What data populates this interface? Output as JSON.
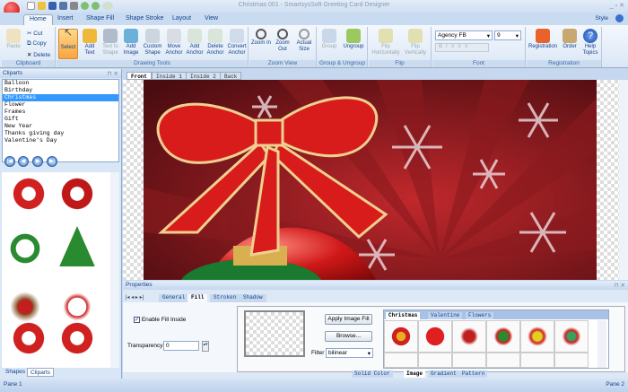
{
  "window": {
    "title": "Christmas 001 - SmartsysSoft Greeting Card Designer",
    "style_label": "Style"
  },
  "tabs": [
    "Home",
    "Insert",
    "Shape Fill",
    "Shape Stroke",
    "Layout",
    "View"
  ],
  "ribbon": {
    "clipboard": {
      "label": "Clipboard",
      "paste": "Paste",
      "cut": "Cut",
      "copy": "Copy",
      "delete": "Delete"
    },
    "drawing": {
      "label": "Drawing Tools",
      "buttons": [
        "Select",
        "Add Text",
        "Text to Shape",
        "Add Image",
        "Custom Shape",
        "Move Anchor",
        "Add Anchor",
        "Delete Anchor",
        "Convert Anchor"
      ]
    },
    "zoom": {
      "label": "Zoom View",
      "buttons": [
        "Zoom In",
        "Zoom Out",
        "Actual Size"
      ]
    },
    "group": {
      "label": "Group & Ungroup",
      "buttons": [
        "Group",
        "Ungroup"
      ]
    },
    "flip": {
      "label": "Flip",
      "buttons": [
        "Flip Horizontally",
        "Flip Vertically"
      ]
    },
    "font": {
      "label": "Font",
      "family": "Agency FB",
      "size": "9",
      "styles": [
        "B",
        "I",
        "≡",
        "≡",
        "≡"
      ]
    },
    "registration": {
      "label": "Registration",
      "buttons": [
        "Registration",
        "Order",
        "Help Topics"
      ]
    }
  },
  "cliparts": {
    "title": "Cliparts",
    "categories": [
      "Balloon",
      "Birthday",
      "Christmas",
      "Flower",
      "Frames",
      "Gift",
      "New Year",
      "Thanks giving day",
      "Valentine's Day"
    ],
    "selected": "Christmas",
    "bottom_tabs": [
      "Shapes",
      "Cliparts"
    ]
  },
  "document": {
    "tabs": [
      "Front",
      "Inside 1",
      "Inside 2",
      "Back"
    ],
    "active": "Front"
  },
  "properties": {
    "title": "Properties",
    "tabs": [
      "General",
      "Fill",
      "Stroken",
      "Shadow"
    ],
    "active": "Fill",
    "enable_fill": "Enable Fill Inside",
    "enable_fill_checked": true,
    "transparency_label": "Transparency",
    "transparency": "0",
    "apply_button": "Apply Image Fill",
    "browse_button": "Browse...",
    "filter_label": "Filter",
    "filter": "bilinear",
    "fill_tabs": [
      "Solid Color",
      "Image",
      "Gradient",
      "Pattern"
    ],
    "active_fill_tab": "Image"
  },
  "clipart_gallery": {
    "tabs": [
      "Christmas",
      "Valentine",
      "Flowers"
    ],
    "active": "Christmas"
  },
  "status": {
    "left": "Pane 1",
    "right": "Pane 2"
  },
  "colors": {
    "accent": "#15428b",
    "ribbon": "#dbe7f6",
    "canvas_bg": "#5a0f12",
    "selection": "#3399ff"
  }
}
